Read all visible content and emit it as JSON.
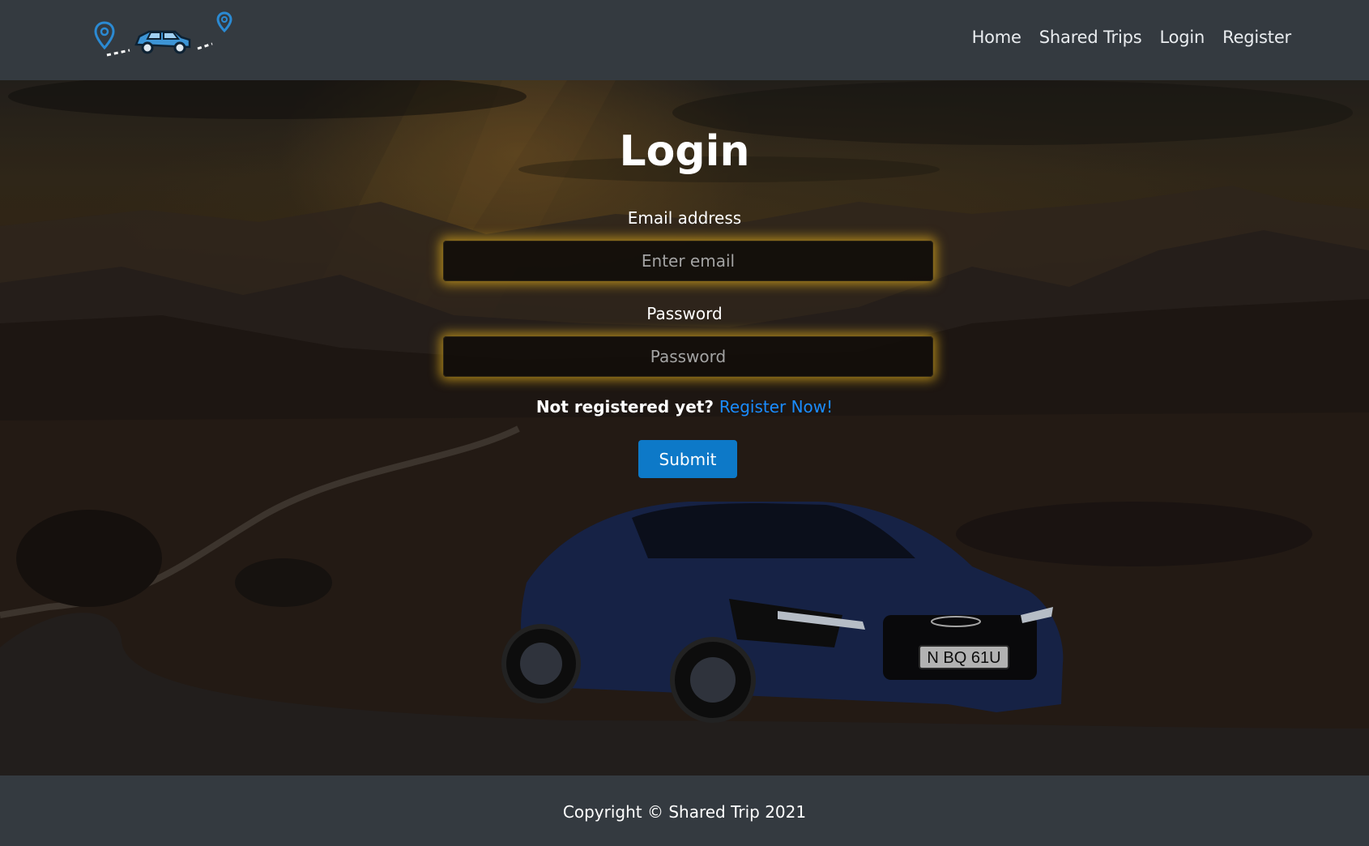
{
  "navbar": {
    "logo_alt": "Shared Trip logo",
    "links": [
      "Home",
      "Shared Trips",
      "Login",
      "Register"
    ]
  },
  "login": {
    "title": "Login",
    "email_label": "Email address",
    "email_placeholder": "Enter email",
    "password_label": "Password",
    "password_placeholder": "Password",
    "not_registered_text": "Not registered yet?",
    "register_link": "Register Now!",
    "submit_label": "Submit"
  },
  "hero": {
    "plate_text": "N BQ 61U"
  },
  "footer": {
    "copyright": "Copyright © Shared Trip 2021"
  },
  "colors": {
    "navbar": "#343a40",
    "accent_link": "#1a8cff",
    "submit": "#0d79c8",
    "input_glow": "#d7a51e"
  }
}
